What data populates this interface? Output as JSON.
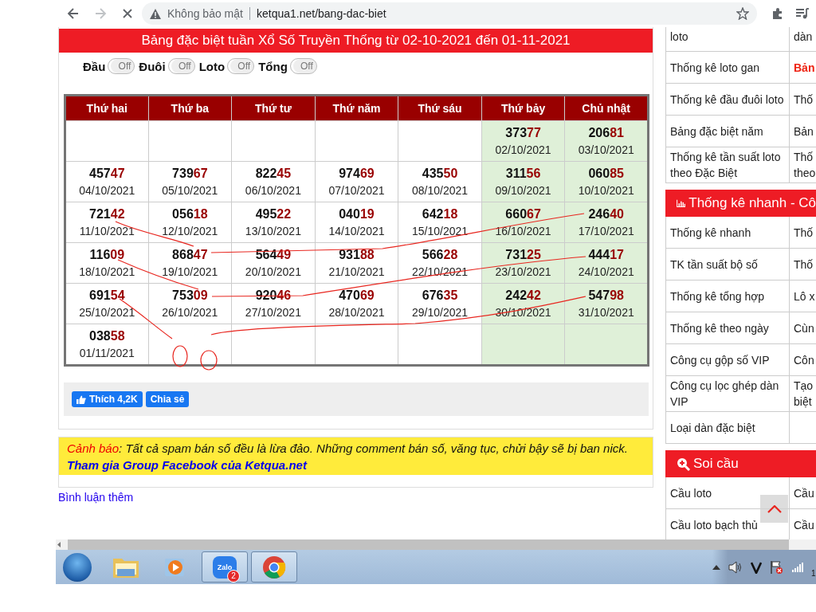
{
  "browser": {
    "security_label": "Không bảo mật",
    "url": "ketqua1.net/bang-dac-biet",
    "loading": true
  },
  "main": {
    "title": "Bảng đặc biệt tuần Xổ Số Truyền Thống từ 02-10-2021 đến 01-11-2021",
    "toggles": [
      {
        "label": "Đầu",
        "value": "Off",
        "on": false
      },
      {
        "label": "Đuôi",
        "value": "Off",
        "on": false
      },
      {
        "label": "Loto",
        "value": "Off",
        "on": false
      },
      {
        "label": "Tổng",
        "value": "Off",
        "on": false
      }
    ],
    "table": {
      "columns": [
        {
          "label": "Thứ hai",
          "weekend": false
        },
        {
          "label": "Thứ ba",
          "weekend": false
        },
        {
          "label": "Thứ tư",
          "weekend": false
        },
        {
          "label": "Thứ năm",
          "weekend": false
        },
        {
          "label": "Thứ sáu",
          "weekend": false
        },
        {
          "label": "Thứ bảy",
          "weekend": true
        },
        {
          "label": "Chủ nhật",
          "weekend": true
        }
      ],
      "rows": [
        [
          null,
          null,
          null,
          null,
          null,
          {
            "number": "37377",
            "date": "02/10/2021"
          },
          {
            "number": "20681",
            "date": "03/10/2021"
          }
        ],
        [
          {
            "number": "45747",
            "date": "04/10/2021"
          },
          {
            "number": "73967",
            "date": "05/10/2021"
          },
          {
            "number": "82245",
            "date": "06/10/2021"
          },
          {
            "number": "97469",
            "date": "07/10/2021"
          },
          {
            "number": "43550",
            "date": "08/10/2021"
          },
          {
            "number": "31156",
            "date": "09/10/2021"
          },
          {
            "number": "06085",
            "date": "10/10/2021"
          }
        ],
        [
          {
            "number": "72142",
            "date": "11/10/2021"
          },
          {
            "number": "05618",
            "date": "12/10/2021"
          },
          {
            "number": "49522",
            "date": "13/10/2021"
          },
          {
            "number": "04019",
            "date": "14/10/2021"
          },
          {
            "number": "64218",
            "date": "15/10/2021"
          },
          {
            "number": "66067",
            "date": "16/10/2021"
          },
          {
            "number": "24640",
            "date": "17/10/2021"
          }
        ],
        [
          {
            "number": "11609",
            "date": "18/10/2021"
          },
          {
            "number": "86847",
            "date": "19/10/2021"
          },
          {
            "number": "56449",
            "date": "20/10/2021"
          },
          {
            "number": "93188",
            "date": "21/10/2021"
          },
          {
            "number": "56628",
            "date": "22/10/2021"
          },
          {
            "number": "73125",
            "date": "23/10/2021"
          },
          {
            "number": "44417",
            "date": "24/10/2021"
          }
        ],
        [
          {
            "number": "69154",
            "date": "25/10/2021"
          },
          {
            "number": "75309",
            "date": "26/10/2021"
          },
          {
            "number": "92046",
            "date": "27/10/2021"
          },
          {
            "number": "47069",
            "date": "28/10/2021"
          },
          {
            "number": "67635",
            "date": "29/10/2021"
          },
          {
            "number": "24242",
            "date": "30/10/2021"
          },
          {
            "number": "54798",
            "date": "31/10/2021"
          }
        ],
        [
          {
            "number": "03858",
            "date": "01/11/2021"
          },
          null,
          null,
          null,
          null,
          null,
          null
        ]
      ]
    },
    "social": {
      "like": "Thích 4,2K",
      "share": "Chia sẻ"
    }
  },
  "warning": {
    "label": "Cảnh báo",
    "text": ": Tất cả spam bán số đều là lừa đảo. Những comment bán số, văng tục, chửi bậy sẽ bị ban nick.",
    "link": "Tham gia Group Facebook của Ketqua.net"
  },
  "more_comments": "Bình luận thêm",
  "sidebar": {
    "sections": [
      {
        "rows": [
          {
            "label": "loto",
            "value": "dàn",
            "highlight": false
          },
          {
            "label": "Thống kê loto gan",
            "value": "Bản",
            "highlight": true
          },
          {
            "label": "Thống kê đầu đuôi loto",
            "value": "Thố",
            "highlight": false
          },
          {
            "label": "Bảng đặc biệt năm",
            "value": "Bản",
            "highlight": false
          },
          {
            "label": "Thống kê tần suất loto theo Đặc Biệt",
            "value": "Thố\ntheo",
            "highlight": false
          }
        ]
      },
      {
        "title": "Thống kê nhanh - Cô",
        "kind": "chart",
        "rows": [
          {
            "label": "Thống kê nhanh",
            "value": "Thố",
            "highlight": false
          },
          {
            "label": "TK tần suất bộ số",
            "value": "Thố",
            "highlight": false
          },
          {
            "label": "Thống kê tổng hợp",
            "value": "Lô x",
            "highlight": false
          },
          {
            "label": "Thống kê theo ngày",
            "value": "Cùn",
            "highlight": false
          },
          {
            "label": "Công cụ gộp số VIP",
            "value": "Côn",
            "highlight": false
          },
          {
            "label": "Công cụ lọc ghép dàn VIP",
            "value": "Tạo\nbiệt",
            "highlight": false
          },
          {
            "label": "Loại dàn đặc biệt"
          }
        ]
      },
      {
        "title": "Soi cầu",
        "kind": "search",
        "rows": [
          {
            "label": "Cầu loto",
            "value": "Cầu",
            "highlight": false
          },
          {
            "label": "Cầu loto bạch thủ",
            "value": "Cầu",
            "highlight": false
          }
        ]
      }
    ]
  },
  "taskbar": {
    "apps": [
      {
        "kind": "explorer",
        "active": false
      },
      {
        "kind": "media",
        "active": false
      },
      {
        "kind": "zalo",
        "active": true,
        "label": "Zalo",
        "badge": "2"
      },
      {
        "kind": "chrome",
        "active": true
      }
    ],
    "clock": "1"
  }
}
